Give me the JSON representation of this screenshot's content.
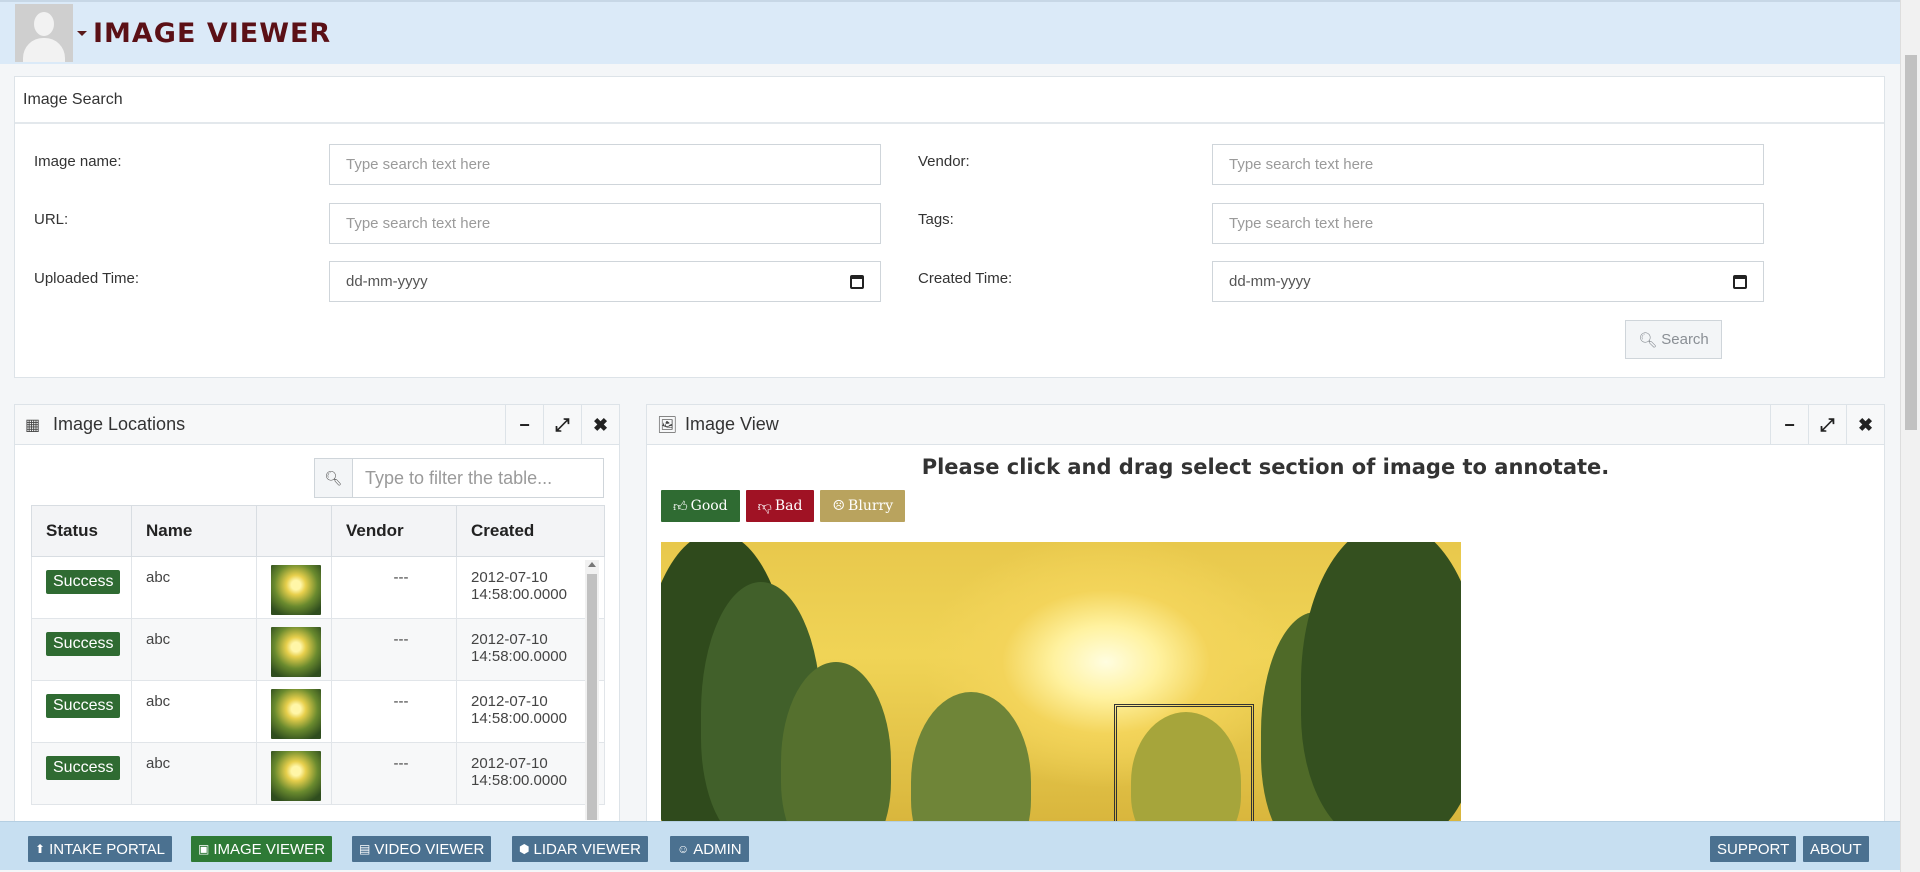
{
  "header": {
    "title": "IMAGE VIEWER"
  },
  "search_panel": {
    "title": "Image Search",
    "fields": {
      "image_name": {
        "label": "Image name:",
        "placeholder": "Type search text here"
      },
      "vendor": {
        "label": "Vendor:",
        "placeholder": "Type search text here"
      },
      "url": {
        "label": "URL:",
        "placeholder": "Type search text here"
      },
      "tags": {
        "label": "Tags:",
        "placeholder": "Type search text here"
      },
      "uploaded_time": {
        "label": "Uploaded Time:",
        "value": "dd-mm-yyyy"
      },
      "created_time": {
        "label": "Created Time:",
        "value": "dd-mm-yyyy"
      }
    },
    "search_button": "Search"
  },
  "locations": {
    "title": "Image Locations",
    "filter_placeholder": "Type to filter the table...",
    "columns": [
      "Status",
      "Name",
      "",
      "Vendor",
      "Created"
    ],
    "rows": [
      {
        "status": "Success",
        "name": "abc",
        "vendor": "---",
        "created_date": "2012-07-10",
        "created_time": "14:58:00.0000"
      },
      {
        "status": "Success",
        "name": "abc",
        "vendor": "---",
        "created_date": "2012-07-10",
        "created_time": "14:58:00.0000"
      },
      {
        "status": "Success",
        "name": "abc",
        "vendor": "---",
        "created_date": "2012-07-10",
        "created_time": "14:58:00.0000"
      },
      {
        "status": "Success",
        "name": "abc",
        "vendor": "---",
        "created_date": "2012-07-10",
        "created_time": "14:58:00.0000"
      }
    ]
  },
  "image_view": {
    "title": "Image View",
    "instruction": "Please click and drag select section of image to annotate.",
    "buttons": {
      "good": "Good",
      "bad": "Bad",
      "blurry": "Blurry"
    }
  },
  "bottom_nav": {
    "items": [
      "INTAKE PORTAL",
      "IMAGE VIEWER",
      "VIDEO VIEWER",
      "LIDAR VIEWER",
      "ADMIN"
    ],
    "right_items": [
      "SUPPORT",
      "ABOUT"
    ]
  },
  "colors": {
    "header_bg": "#dbeaf8",
    "title_color": "#5b1016",
    "success": "#2f6b32",
    "bad": "#a01224",
    "blurry": "#b9a35e",
    "nav_button": "#4b7190",
    "nav_active": "#2e7a36"
  },
  "icons": [
    "user-avatar",
    "caret-down-icon",
    "search-icon",
    "table-icon",
    "picture-icon",
    "minimize-icon",
    "expand-icon",
    "close-icon",
    "thumbs-up-icon",
    "thumbs-down-icon",
    "frown-icon",
    "calendar-icon",
    "upload-icon",
    "file-icon",
    "cube-icon",
    "user-icon"
  ]
}
